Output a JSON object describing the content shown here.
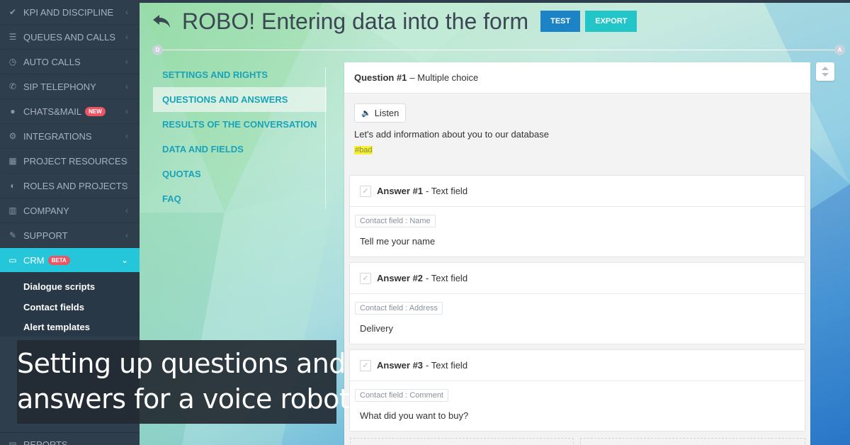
{
  "sidebar": {
    "items": [
      {
        "label": "KPI AND DISCIPLINE",
        "icon": "check-icon"
      },
      {
        "label": "QUEUES AND CALLS",
        "icon": "list-icon"
      },
      {
        "label": "AUTO CALLS",
        "icon": "clock-icon"
      },
      {
        "label": "SIP TELEPHONY",
        "icon": "phone-icon"
      },
      {
        "label": "CHATS&MAIL",
        "icon": "chat-icon",
        "badge": "NEW"
      },
      {
        "label": "INTEGRATIONS",
        "icon": "cogs-icon"
      },
      {
        "label": "PROJECT RESOURCES",
        "icon": "grid-icon"
      },
      {
        "label": "ROLES AND PROJECTS",
        "icon": "toggle-icon"
      },
      {
        "label": "COMPANY",
        "icon": "bar-chart-icon"
      },
      {
        "label": "SUPPORT",
        "icon": "wrench-icon"
      },
      {
        "label": "CRM",
        "icon": "card-icon",
        "badge": "BETA",
        "active": true
      }
    ],
    "crm_sub_items": [
      "Dialogue scripts",
      "Contact fields",
      "Alert templates"
    ],
    "bottom_item": "REPORTS"
  },
  "header": {
    "title": "ROBO! Entering data into the form",
    "test_label": "TEST",
    "export_label": "EXPORT"
  },
  "timeline": {
    "start_marker": "D",
    "end_marker": "A"
  },
  "section_menu": {
    "items": [
      "SETTINGS AND RIGHTS",
      "QUESTIONS AND ANSWERS",
      "RESULTS OF THE CONVERSATION",
      "DATA AND FIELDS",
      "QUOTAS",
      "FAQ"
    ],
    "active_index": 1
  },
  "question": {
    "number_label": "Question #1",
    "type": "– Multiple choice",
    "listen_label": "Listen",
    "text": "Let's add information about you to our database",
    "tag": "#bad"
  },
  "answers": [
    {
      "number_label": "Answer #1",
      "type": "- Text field",
      "field": "Contact field : Name",
      "text": "Tell me your name"
    },
    {
      "number_label": "Answer #2",
      "type": "- Text field",
      "field": "Contact field : Address",
      "text": "Delivery"
    },
    {
      "number_label": "Answer #3",
      "type": "- Text field",
      "field": "Contact field : Comment",
      "text": "What did you want to buy?"
    }
  ],
  "caption": {
    "line1": "Setting up questions and",
    "line2": "answers for a voice robot"
  },
  "colors": {
    "sidebar_bg": "#2f3e4c",
    "active_accent": "#26c6da",
    "test_button": "#1c84c6",
    "export_button": "#23c6c8",
    "menu_text": "#1aa3b8"
  }
}
